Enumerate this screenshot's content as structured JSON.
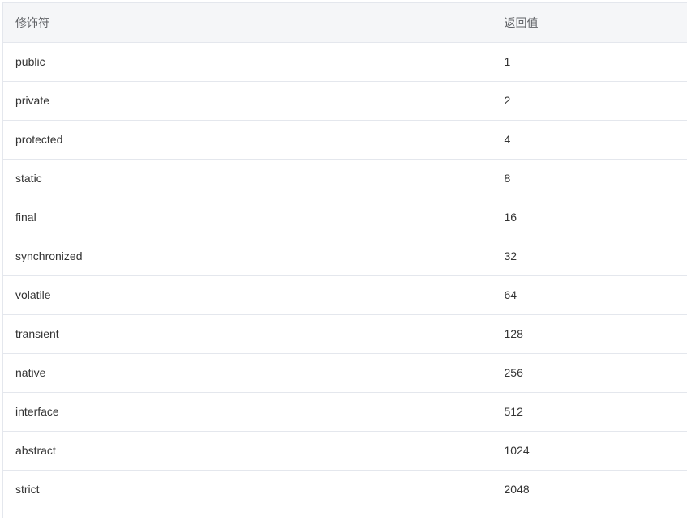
{
  "table": {
    "headers": [
      "修饰符",
      "返回值"
    ],
    "rows": [
      [
        "public",
        "1"
      ],
      [
        "private",
        "2"
      ],
      [
        "protected",
        "4"
      ],
      [
        "static",
        "8"
      ],
      [
        "final",
        "16"
      ],
      [
        "synchronized",
        "32"
      ],
      [
        "volatile",
        "64"
      ],
      [
        "transient",
        "128"
      ],
      [
        "native",
        "256"
      ],
      [
        "interface",
        "512"
      ],
      [
        "abstract",
        "1024"
      ],
      [
        "strict",
        "2048"
      ]
    ]
  },
  "colors": {
    "header_bg": "#f5f6f8",
    "border": "#e4e7ed",
    "header_text": "#606266",
    "body_text": "#333333"
  }
}
